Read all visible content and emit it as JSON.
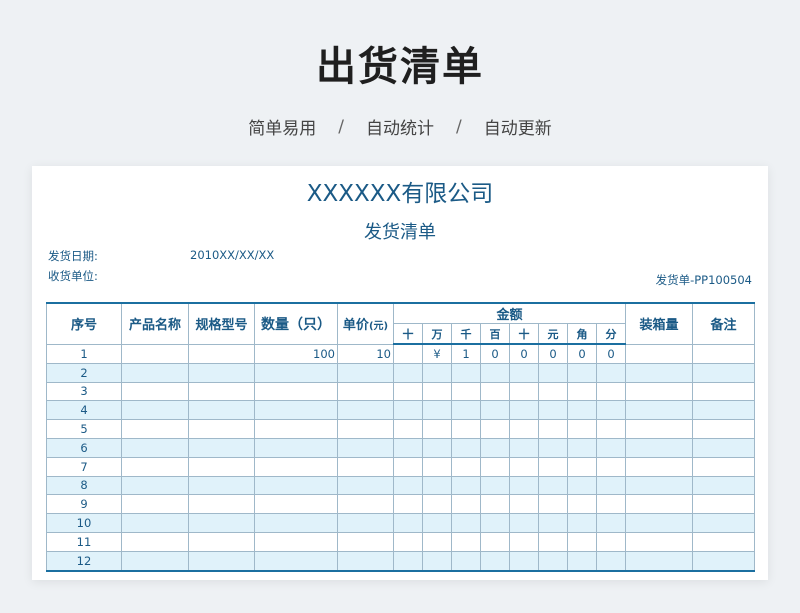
{
  "hero": {
    "title": "出货清单",
    "features": [
      "简单易用",
      "自动统计",
      "自动更新"
    ],
    "separator": "/"
  },
  "sheet": {
    "company": "XXXXXX有限公司",
    "doc_title": "发货清单",
    "date_label": "发货日期:",
    "date_value": "2010XX/XX/XX",
    "unit_label": "收货单位:",
    "doc_no": "发货单-PP100504"
  },
  "table": {
    "headers": {
      "seq": "序号",
      "product": "产品名称",
      "spec": "规格型号",
      "qty": "数量（只）",
      "price": "单价",
      "price_unit": "(元)",
      "amount": "金额",
      "digits": [
        "十",
        "万",
        "千",
        "百",
        "十",
        "元",
        "角",
        "分"
      ],
      "packing": "装箱量",
      "remark": "备注"
    },
    "rows": [
      {
        "seq": "1",
        "product": "",
        "spec": "",
        "qty": "100",
        "price": "10",
        "digits": [
          "",
          "¥",
          "1",
          "0",
          "0",
          "0",
          "0",
          "0"
        ],
        "packing": "",
        "remark": ""
      },
      {
        "seq": "2",
        "product": "",
        "spec": "",
        "qty": "",
        "price": "",
        "digits": [
          "",
          "",
          "",
          "",
          "",
          "",
          "",
          ""
        ],
        "packing": "",
        "remark": ""
      },
      {
        "seq": "3",
        "product": "",
        "spec": "",
        "qty": "",
        "price": "",
        "digits": [
          "",
          "",
          "",
          "",
          "",
          "",
          "",
          ""
        ],
        "packing": "",
        "remark": ""
      },
      {
        "seq": "4",
        "product": "",
        "spec": "",
        "qty": "",
        "price": "",
        "digits": [
          "",
          "",
          "",
          "",
          "",
          "",
          "",
          ""
        ],
        "packing": "",
        "remark": ""
      },
      {
        "seq": "5",
        "product": "",
        "spec": "",
        "qty": "",
        "price": "",
        "digits": [
          "",
          "",
          "",
          "",
          "",
          "",
          "",
          ""
        ],
        "packing": "",
        "remark": ""
      },
      {
        "seq": "6",
        "product": "",
        "spec": "",
        "qty": "",
        "price": "",
        "digits": [
          "",
          "",
          "",
          "",
          "",
          "",
          "",
          ""
        ],
        "packing": "",
        "remark": ""
      },
      {
        "seq": "7",
        "product": "",
        "spec": "",
        "qty": "",
        "price": "",
        "digits": [
          "",
          "",
          "",
          "",
          "",
          "",
          "",
          ""
        ],
        "packing": "",
        "remark": ""
      },
      {
        "seq": "8",
        "product": "",
        "spec": "",
        "qty": "",
        "price": "",
        "digits": [
          "",
          "",
          "",
          "",
          "",
          "",
          "",
          ""
        ],
        "packing": "",
        "remark": ""
      },
      {
        "seq": "9",
        "product": "",
        "spec": "",
        "qty": "",
        "price": "",
        "digits": [
          "",
          "",
          "",
          "",
          "",
          "",
          "",
          ""
        ],
        "packing": "",
        "remark": ""
      },
      {
        "seq": "10",
        "product": "",
        "spec": "",
        "qty": "",
        "price": "",
        "digits": [
          "",
          "",
          "",
          "",
          "",
          "",
          "",
          ""
        ],
        "packing": "",
        "remark": ""
      },
      {
        "seq": "11",
        "product": "",
        "spec": "",
        "qty": "",
        "price": "",
        "digits": [
          "",
          "",
          "",
          "",
          "",
          "",
          "",
          ""
        ],
        "packing": "",
        "remark": ""
      },
      {
        "seq": "12",
        "product": "",
        "spec": "",
        "qty": "",
        "price": "",
        "digits": [
          "",
          "",
          "",
          "",
          "",
          "",
          "",
          ""
        ],
        "packing": "",
        "remark": ""
      }
    ]
  }
}
